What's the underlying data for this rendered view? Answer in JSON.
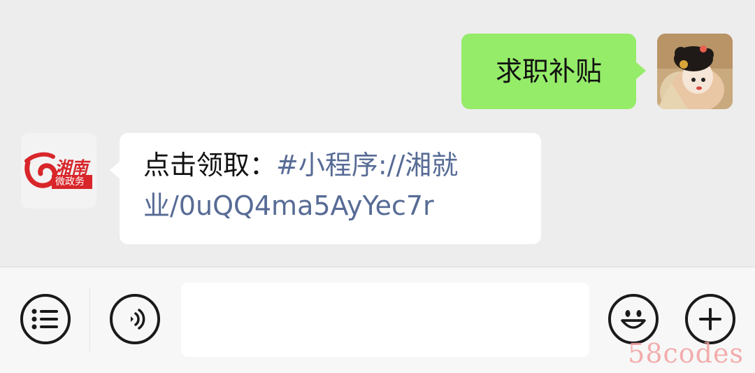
{
  "chat": {
    "messages": [
      {
        "sender": "me",
        "text": "求职补贴"
      },
      {
        "sender": "other",
        "avatar_text_top": "湘南",
        "avatar_text_bottom": "微政务",
        "prefix": "点击领取：",
        "link": "#小程序://湘就业/0uQQ4ma5AyYec7r"
      }
    ]
  },
  "input_bar": {
    "menu_icon": "list-icon",
    "voice_icon": "voice-icon",
    "emoji_icon": "emoji-icon",
    "plus_icon": "plus-icon",
    "text_value": ""
  },
  "watermark": "58codes",
  "colors": {
    "bubble_me": "#95ec69",
    "bubble_other": "#ffffff",
    "link": "#576b95",
    "chat_bg": "#ededed",
    "logo_red": "#d8262a"
  }
}
